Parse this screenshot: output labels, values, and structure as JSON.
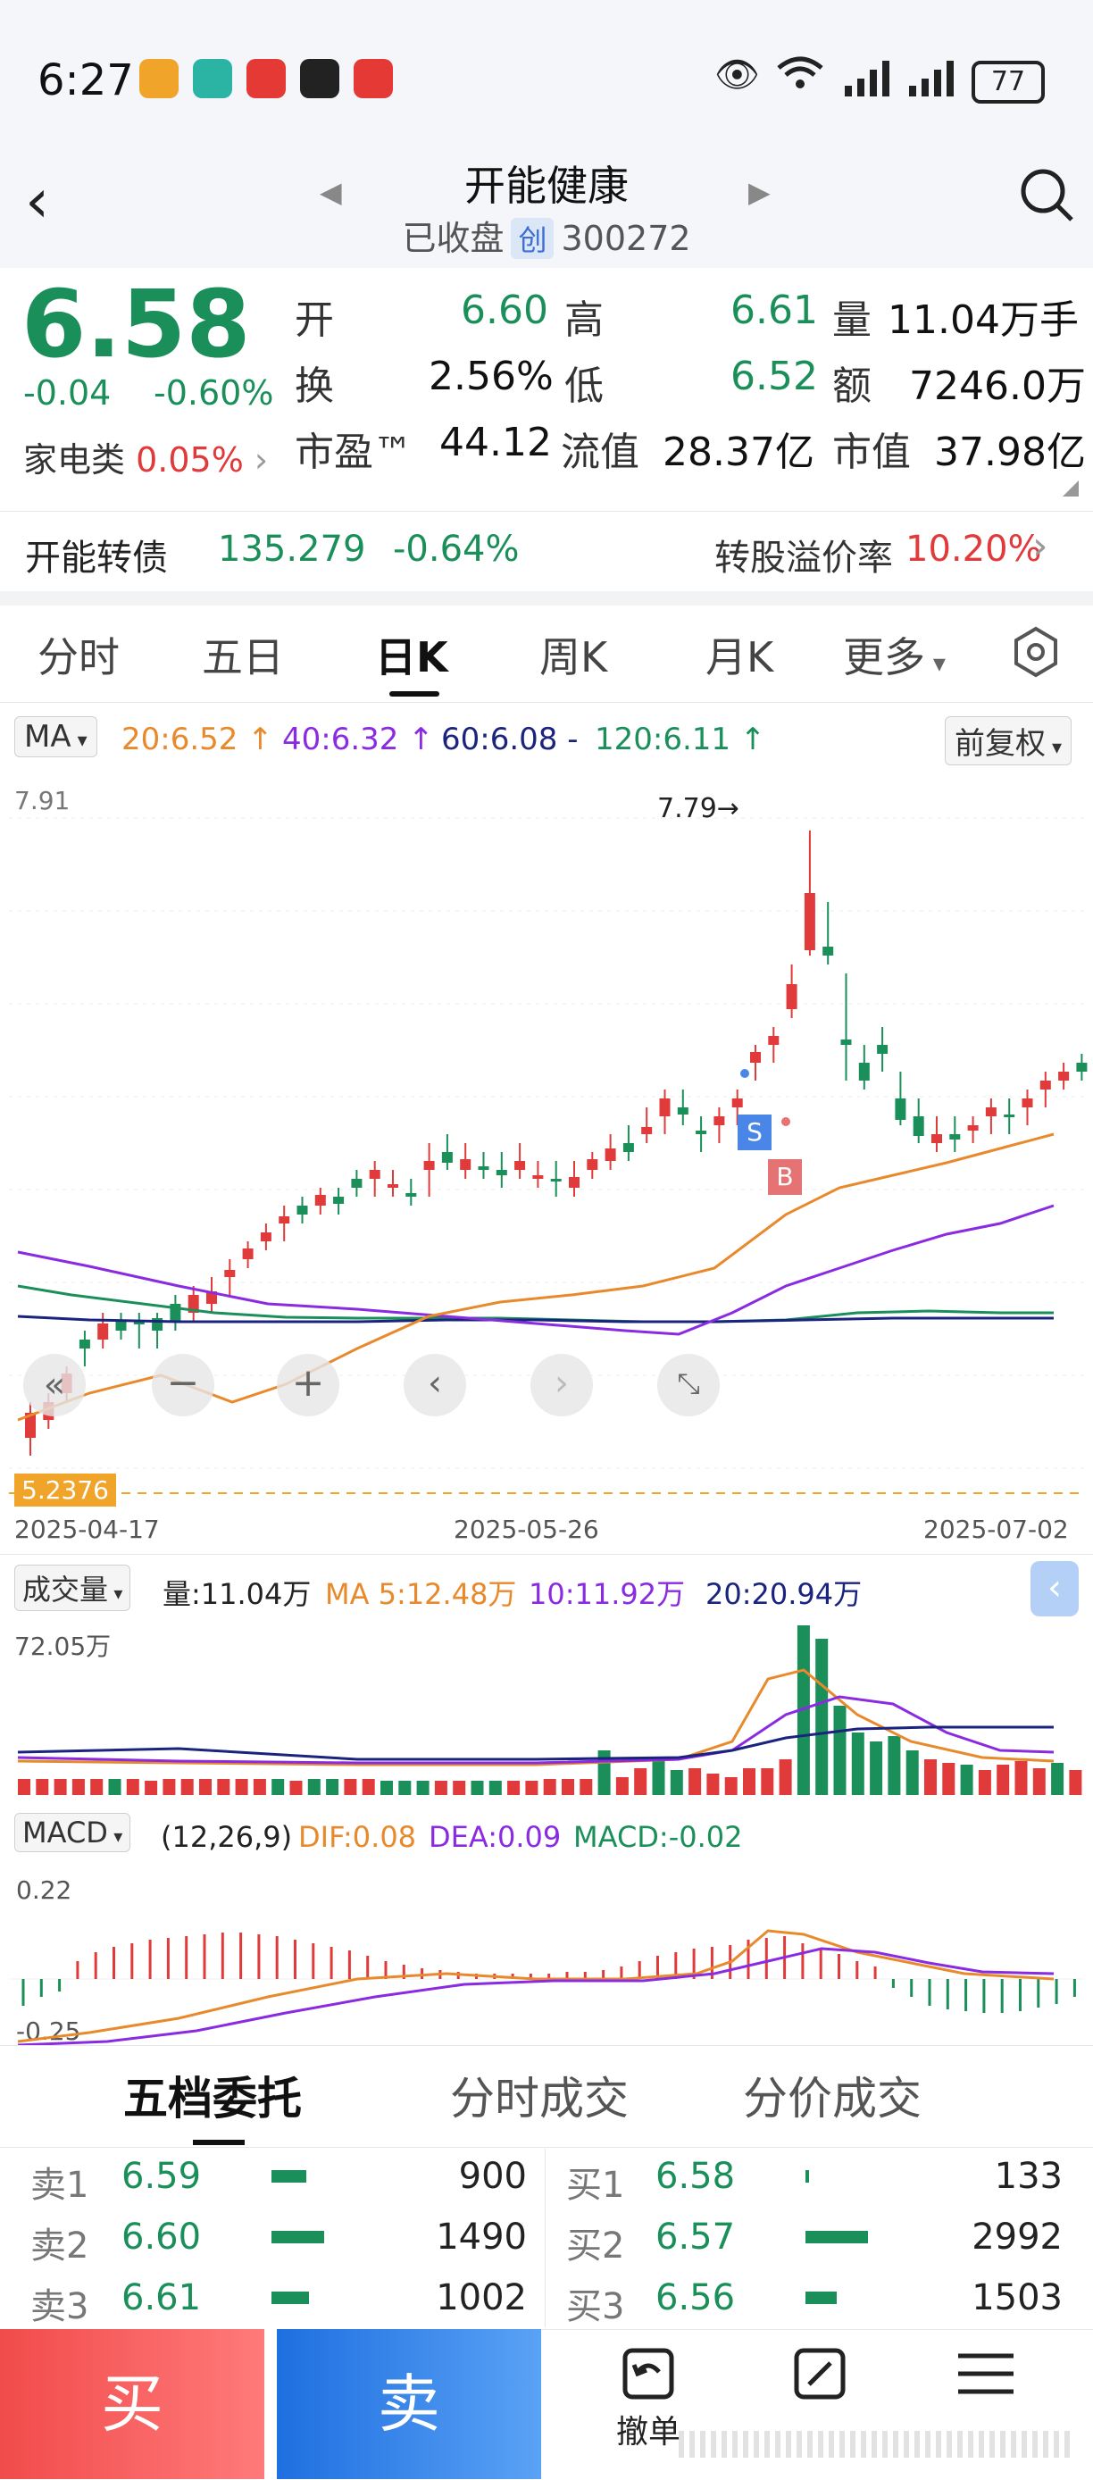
{
  "status_bar": {
    "time": "6:27",
    "battery": "77",
    "notification_colors": [
      "#f0a42a",
      "#2bb3a4",
      "#e53935",
      "#222222",
      "#e53935"
    ]
  },
  "header": {
    "title": "开能健康",
    "status": "已收盘",
    "board_tag": "创",
    "code": "300272"
  },
  "quote": {
    "price": "6.58",
    "change": "-0.04",
    "change_pct": "-0.60%",
    "sector_label": "家电类",
    "sector_pct": "0.05%",
    "rows": [
      [
        {
          "label": "开",
          "value": "6.60",
          "color": "green"
        },
        {
          "label": "高",
          "value": "6.61",
          "color": "green"
        },
        {
          "label": "量",
          "value": "11.04万手",
          "color": "dark"
        }
      ],
      [
        {
          "label": "换",
          "value": "2.56%",
          "color": "dark"
        },
        {
          "label": "低",
          "value": "6.52",
          "color": "green"
        },
        {
          "label": "额",
          "value": "7246.0万",
          "color": "dark"
        }
      ],
      [
        {
          "label": "市盈™",
          "value": "44.12",
          "color": "dark"
        },
        {
          "label": "流值",
          "value": "28.37亿",
          "color": "dark"
        },
        {
          "label": "市值",
          "value": "37.98亿",
          "color": "dark"
        }
      ]
    ]
  },
  "convertible": {
    "name": "开能转债",
    "price": "135.279",
    "pct": "-0.64%",
    "premium_label": "转股溢价率",
    "premium_value": "10.20%"
  },
  "tabs": [
    "分时",
    "五日",
    "日K",
    "周K",
    "月K",
    "更多"
  ],
  "active_tab": "日K",
  "ma_bar": {
    "select": "MA",
    "ma20": "20:6.52",
    "ma40": "40:6.32",
    "ma60": "60:6.08 -",
    "ma120": "120:6.11",
    "adjust": "前复权"
  },
  "kline": {
    "top_label": "7.91",
    "high_marker": "7.79",
    "low_label": "5.2376",
    "dates": [
      "2025-04-17",
      "2025-05-26",
      "2025-07-02"
    ],
    "badge_s": "S",
    "badge_b": "B"
  },
  "volume_bar": {
    "select": "成交量",
    "vol": "量:11.04万",
    "ma5": "MA 5:12.48万",
    "ma10": "10:11.92万",
    "ma20": "20:20.94万",
    "max_label": "72.05万"
  },
  "macd_bar": {
    "select": "MACD",
    "params": "(12,26,9)",
    "dif": "DIF:0.08",
    "dea": "DEA:0.09",
    "macd": "MACD:-0.02",
    "top": "0.22",
    "bottom": "-0.25"
  },
  "book_tabs": [
    "五档委托",
    "分时成交",
    "分价成交"
  ],
  "book": {
    "sell": [
      {
        "label": "卖1",
        "price": "6.59",
        "vol": "900",
        "bar": 0.3
      },
      {
        "label": "卖2",
        "price": "6.60",
        "vol": "1490",
        "bar": 0.45
      },
      {
        "label": "卖3",
        "price": "6.61",
        "vol": "1002",
        "bar": 0.32
      }
    ],
    "buy": [
      {
        "label": "买1",
        "price": "6.58",
        "vol": "133",
        "bar": 0.05
      },
      {
        "label": "买2",
        "price": "6.57",
        "vol": "2992",
        "bar": 1.0
      },
      {
        "label": "买3",
        "price": "6.56",
        "vol": "1503",
        "bar": 0.5
      }
    ]
  },
  "actions": {
    "buy": "买",
    "sell": "卖",
    "cancel": "撤单"
  },
  "colors": {
    "up": "#e03a3a",
    "down": "#1a8f5a",
    "ma20": "#e8892b",
    "ma40": "#8a2be2",
    "ma60": "#1a237e",
    "ma120": "#1a8f5a"
  }
}
